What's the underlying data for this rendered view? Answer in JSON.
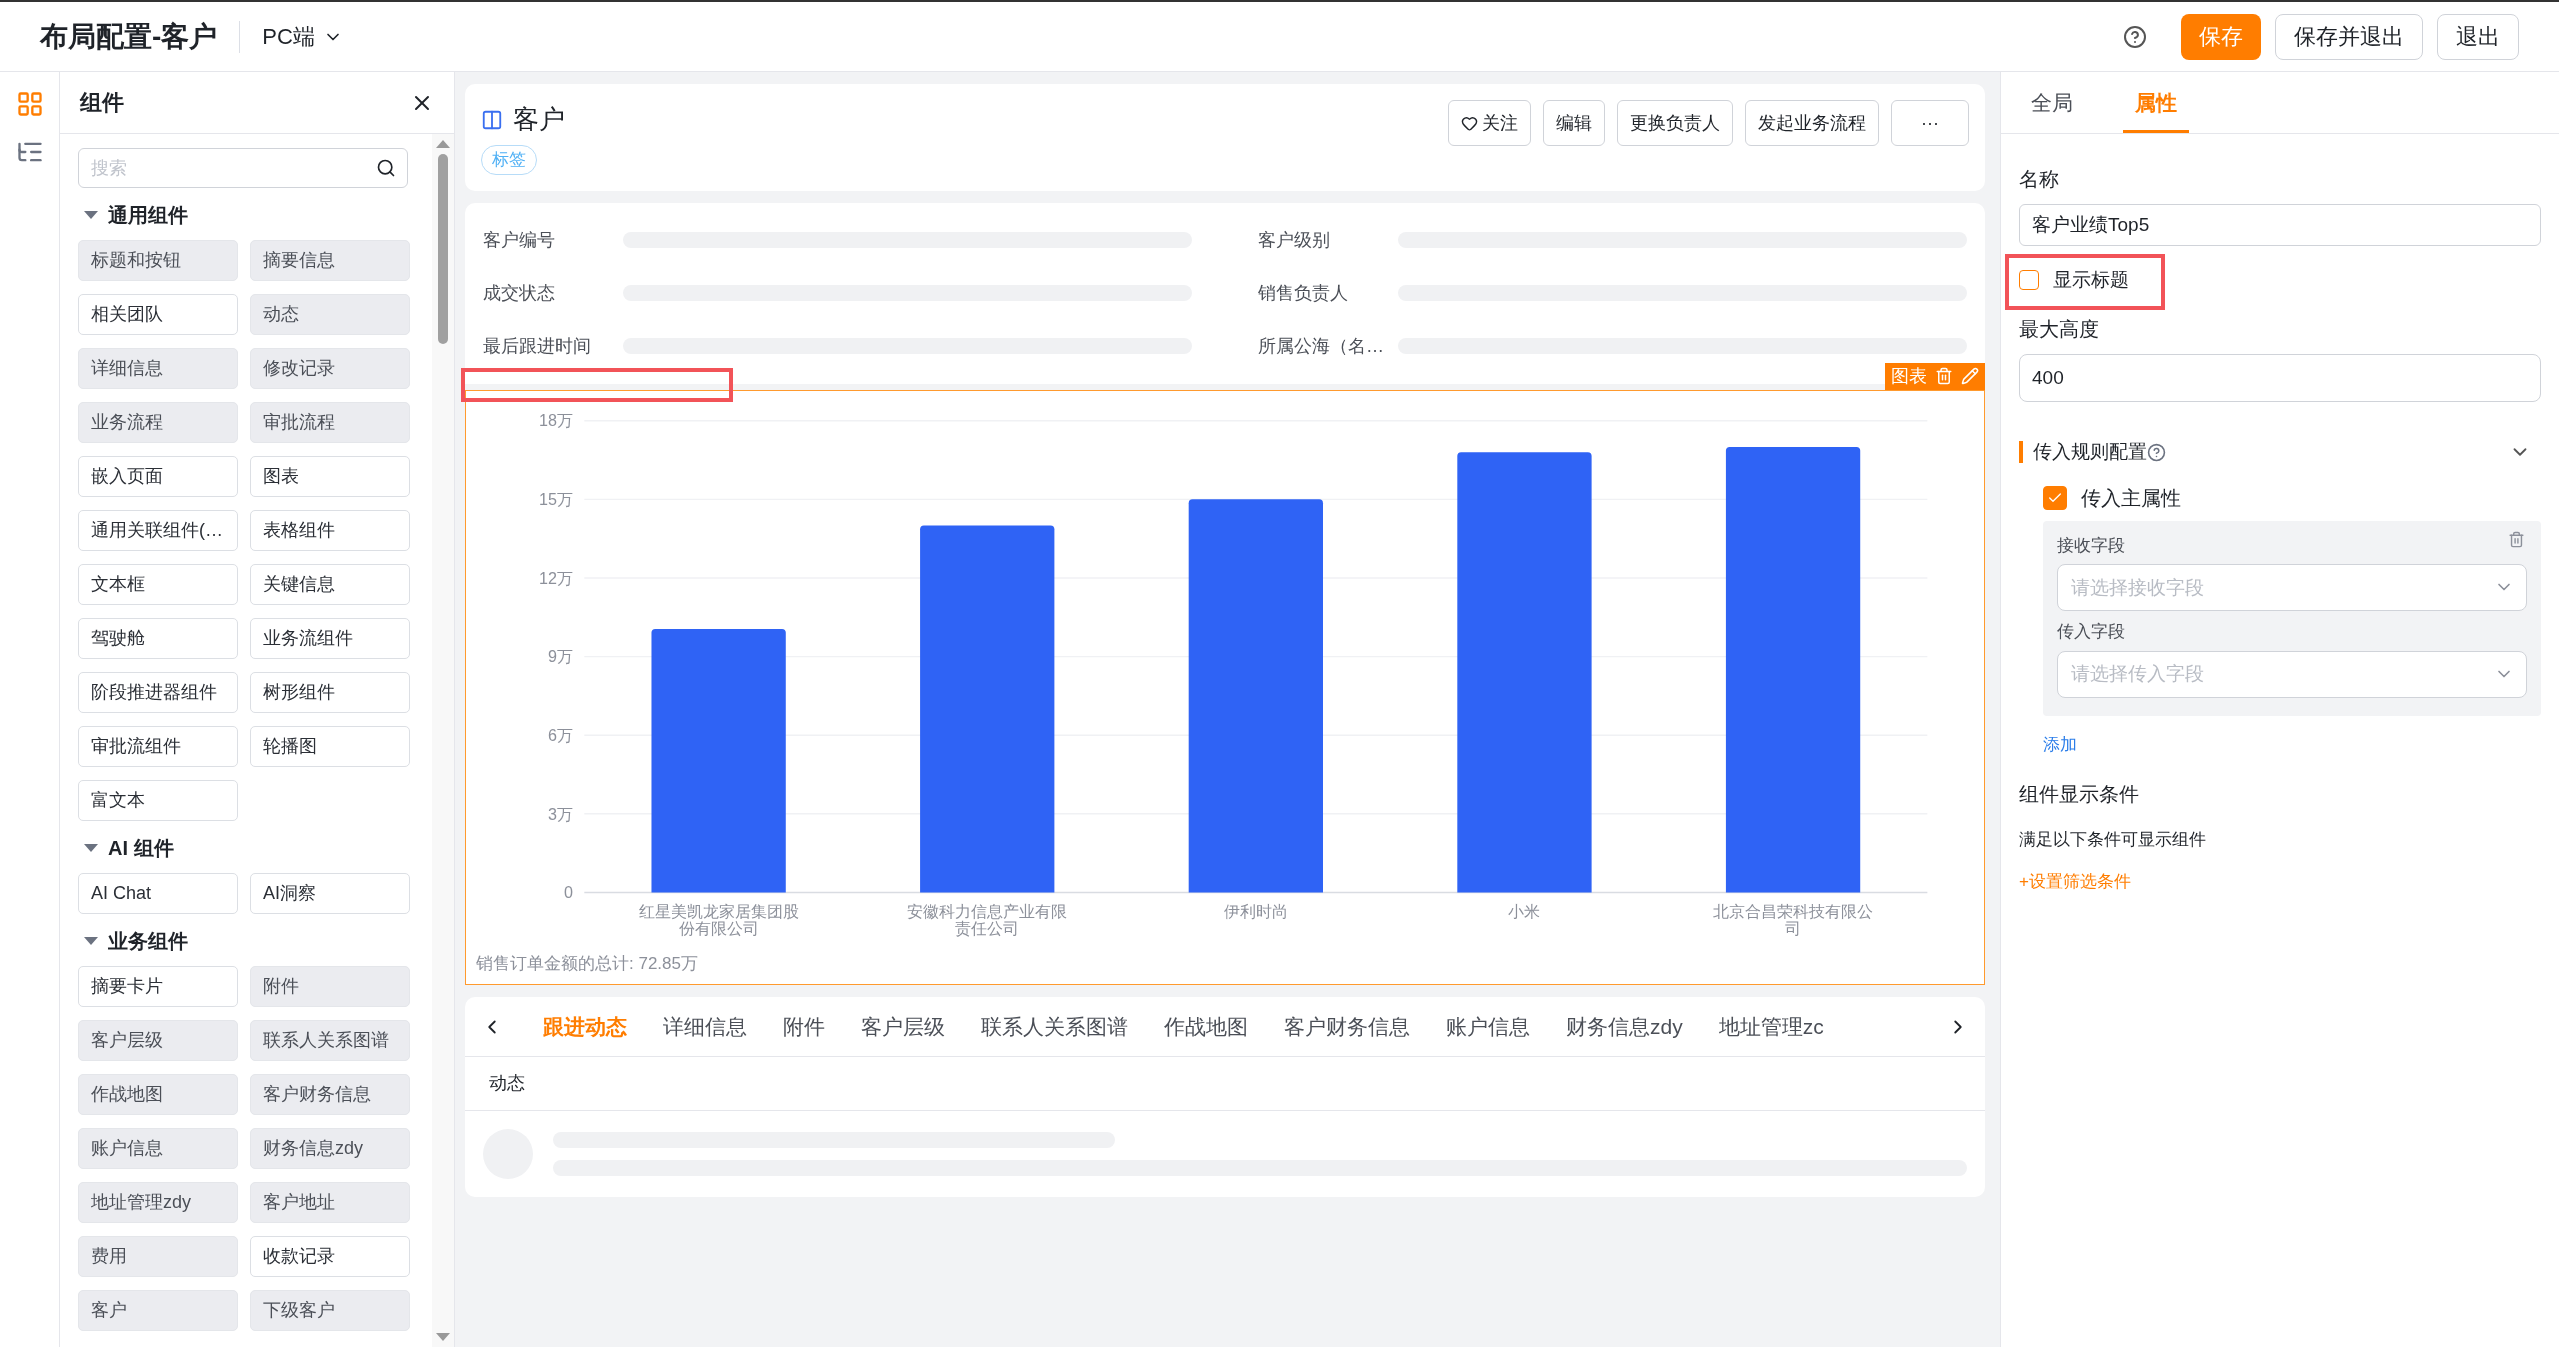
{
  "header": {
    "title": "布局配置-客户",
    "platform": "PC端",
    "buttons": [
      {
        "label": "保存",
        "kind": "primary"
      },
      {
        "label": "保存并退出",
        "kind": "plain"
      },
      {
        "label": "退出",
        "kind": "plain"
      }
    ]
  },
  "rail": [
    {
      "selected": true
    },
    {
      "selected": false
    }
  ],
  "components_panel": {
    "title": "组件",
    "search": {
      "placeholder": "搜索"
    },
    "groups": [
      {
        "title": "通用组件",
        "expanded": true,
        "items": [
          {
            "label": "标题和按钮",
            "disabled": true
          },
          {
            "label": "摘要信息",
            "disabled": true
          },
          {
            "label": "相关团队",
            "disabled": false
          },
          {
            "label": "动态",
            "disabled": true
          },
          {
            "label": "详细信息",
            "disabled": true
          },
          {
            "label": "修改记录",
            "disabled": true
          },
          {
            "label": "业务流程",
            "disabled": true
          },
          {
            "label": "审批流程",
            "disabled": true
          },
          {
            "label": "嵌入页面",
            "disabled": false
          },
          {
            "label": "图表",
            "disabled": false
          },
          {
            "label": "通用关联组件(…",
            "disabled": false
          },
          {
            "label": "表格组件",
            "disabled": false
          },
          {
            "label": "文本框",
            "disabled": false
          },
          {
            "label": "关键信息",
            "disabled": false
          },
          {
            "label": "驾驶舱",
            "disabled": false
          },
          {
            "label": "业务流组件",
            "disabled": false
          },
          {
            "label": "阶段推进器组件",
            "disabled": false
          },
          {
            "label": "树形组件",
            "disabled": false
          },
          {
            "label": "审批流组件",
            "disabled": false
          },
          {
            "label": "轮播图",
            "disabled": false
          },
          {
            "label": "富文本",
            "disabled": false
          }
        ]
      },
      {
        "title": "AI 组件",
        "expanded": true,
        "items": [
          {
            "label": "AI Chat",
            "disabled": false
          },
          {
            "label": "AI洞察",
            "disabled": false
          }
        ]
      },
      {
        "title": "业务组件",
        "expanded": true,
        "items": [
          {
            "label": "摘要卡片",
            "disabled": false
          },
          {
            "label": "附件",
            "disabled": true
          },
          {
            "label": "客户层级",
            "disabled": true
          },
          {
            "label": "联系人关系图谱",
            "disabled": true
          },
          {
            "label": "作战地图",
            "disabled": true
          },
          {
            "label": "客户财务信息",
            "disabled": true
          },
          {
            "label": "账户信息",
            "disabled": true
          },
          {
            "label": "财务信息zdy",
            "disabled": true
          },
          {
            "label": "地址管理zdy",
            "disabled": true
          },
          {
            "label": "客户地址",
            "disabled": true
          },
          {
            "label": "费用",
            "disabled": true
          },
          {
            "label": "收款记录",
            "disabled": false
          },
          {
            "label": "客户",
            "disabled": true
          },
          {
            "label": "下级客户",
            "disabled": true
          }
        ]
      }
    ]
  },
  "record": {
    "title": "客户",
    "tag": "标签",
    "buttons": [
      {
        "label": "关注",
        "kind": "follow"
      },
      {
        "label": "编辑",
        "kind": "plain"
      },
      {
        "label": "更换负责人",
        "kind": "plain"
      },
      {
        "label": "发起业务流程",
        "kind": "plain"
      },
      {
        "label": "···",
        "kind": "plain"
      }
    ]
  },
  "fields": [
    {
      "label": "客户编号"
    },
    {
      "label": "客户级别"
    },
    {
      "label": "成交状态"
    },
    {
      "label": "销售负责人"
    },
    {
      "label": "最后跟进时间"
    },
    {
      "label": "所属公海（名…"
    }
  ],
  "chart": {
    "toolbar_label": "图表",
    "title_highlighted": true,
    "total": "销售订单金额的总计: 72.85万",
    "chart_data": {
      "type": "bar",
      "categories": [
        "红星美凯龙家居集团股份有限公司",
        "安徽科力信息产业有限责任公司",
        "伊利时尚",
        "小米",
        "北京合昌荣科技有限公司"
      ],
      "series": [
        {
          "color": "#2f63f5",
          "values": [
            10.05,
            14,
            15,
            16.8,
            17
          ]
        }
      ],
      "ylim": [
        0,
        18
      ],
      "grid": true,
      "yticks": [
        {
          "value": 0,
          "label": "0"
        },
        {
          "value": 3,
          "label": "3万"
        },
        {
          "value": 6,
          "label": "6万"
        },
        {
          "value": 9,
          "label": "9万"
        },
        {
          "value": 12,
          "label": "12万"
        },
        {
          "value": 15,
          "label": "15万"
        },
        {
          "value": 18,
          "label": "18万"
        }
      ]
    }
  },
  "tabs": [
    {
      "label": "跟进动态",
      "selected": true
    },
    {
      "label": "详细信息",
      "selected": false
    },
    {
      "label": "附件",
      "selected": false
    },
    {
      "label": "客户层级",
      "selected": false
    },
    {
      "label": "联系人关系图谱",
      "selected": false
    },
    {
      "label": "作战地图",
      "selected": false
    },
    {
      "label": "客户财务信息",
      "selected": false
    },
    {
      "label": "账户信息",
      "selected": false
    },
    {
      "label": "财务信息zdy",
      "selected": false
    },
    {
      "label": "地址管理zc",
      "selected": false
    }
  ],
  "activity_heading": "动态",
  "properties": {
    "tabs": [
      {
        "label": "全局",
        "selected": false
      },
      {
        "label": "属性",
        "selected": true
      }
    ],
    "name_label": "名称",
    "name_value": "客户业绩Top5",
    "show_title": {
      "label": "显示标题",
      "checked": false,
      "highlighted": true
    },
    "max_height_label": "最大高度",
    "max_height_value": "400",
    "rules": {
      "title": "传入规则配置",
      "expanded": true,
      "main_attr": {
        "label": "传入主属性",
        "checked": true
      },
      "fields": [
        {
          "label": "接收字段",
          "placeholder": "请选择接收字段"
        },
        {
          "label": "传入字段",
          "placeholder": "请选择传入字段"
        }
      ],
      "add": "添加"
    },
    "condition": {
      "title": "组件显示条件",
      "desc": "满足以下条件可显示组件",
      "link": "+设置筛选条件"
    }
  }
}
